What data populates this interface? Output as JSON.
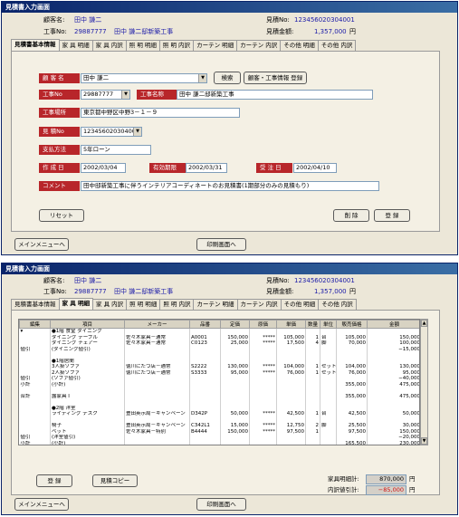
{
  "window1": {
    "title": "見積書入力画面",
    "header": {
      "customer_label": "顧客名:",
      "customer_value": "田中 謙二",
      "job_no_label": "工事No:",
      "job_no_value": "29887777",
      "job_name_value": "田中 謙二邸新築工事",
      "estimate_no_label": "見積No:",
      "estimate_no_value": "123456020304001",
      "total_label": "見積金額:",
      "total_value": "1,357,000",
      "yen": "円"
    },
    "tabs": [
      "見積書基本情報",
      "家 具 明細",
      "家 具 内訳",
      "照 明 明細",
      "照 明 内訳",
      "カーテン 明細",
      "カーテン 内訳",
      "その他 明細",
      "その他 内訳"
    ],
    "form": {
      "customer_label": "顧 客 名",
      "customer_value": "田中 謙二",
      "search_button": "検索",
      "register_button": "顧客・工事情報 登録",
      "job_no_label": "工事No",
      "job_no_value": "29887777",
      "job_name_label": "工事名称",
      "job_name_value": "田中 謙二邸新築工事",
      "location_label": "工事場所",
      "location_value": "東京都中野区中野3－１－９",
      "estimate_no_label": "見 積No",
      "estimate_no_value": "123456020304001",
      "payment_label": "支払方法",
      "payment_value": "5年ローン",
      "created_label": "作 成 日",
      "created_value": "2002/03/04",
      "valid_label": "有効期限",
      "valid_value": "2002/03/31",
      "order_label": "受 注 日",
      "order_value": "2002/04/10",
      "comment_label": "コメント",
      "comment_value": "田中邸新築工事に伴うインテリアコーディネートのお見積書(1期部分のみの見積もり)",
      "reset_button": "リセット",
      "delete_button": "削 除",
      "save_button": "登 録"
    },
    "footer": {
      "menu_button": "メインメニューへ",
      "print_button": "印刷画面へ"
    }
  },
  "window2": {
    "title": "見積書入力画面",
    "header": {
      "customer_label": "顧客名:",
      "customer_value": "田中 謙二",
      "job_no_label": "工事No:",
      "job_no_value": "29887777",
      "job_name_value": "田中 謙二邸新築工事",
      "estimate_no_label": "見積No:",
      "estimate_no_value": "123456020304001",
      "total_label": "見積金額:",
      "total_value": "1,357,000",
      "yen": "円"
    },
    "tabs": [
      "見積書基本情報",
      "家 具 明細",
      "家 具 内訳",
      "照 明 明細",
      "照 明 内訳",
      "カーテン 明細",
      "カーテン 内訳",
      "その他 明細",
      "その他 内訳"
    ],
    "grid": {
      "columns": [
        "編集",
        "項目",
        "メーカー",
        "品番",
        "定価",
        "原価",
        "単価",
        "数量",
        "単位",
        "販売価格",
        "金額"
      ],
      "rows": [
        [
          "▾",
          "●1階 食堂 ダイニング",
          "",
          "",
          "",
          "",
          "",
          "",
          "",
          "",
          ""
        ],
        [
          "",
          "ダイニング テーブル",
          "佐々木家具－通常",
          "A0001",
          "150,000",
          "*****",
          "105,000",
          "1",
          "台",
          "105,000",
          "150,000"
        ],
        [
          "",
          "ダイニング チェアー",
          "佐々木家具－通常",
          "C0123",
          "25,000",
          "*****",
          "17,500",
          "4",
          "脚",
          "70,000",
          "100,000"
        ],
        [
          "値引",
          "(ダイニング値引)",
          "",
          "",
          "",
          "",
          "",
          "",
          "",
          "",
          "−15,000"
        ],
        [
          "",
          "",
          "",
          "",
          "",
          "",
          "",
          "",
          "",
          "",
          ""
        ],
        [
          "",
          "●1階居間",
          "",
          "",
          "",
          "",
          "",
          "",
          "",
          "",
          ""
        ],
        [
          "",
          "3人掛ソファ",
          "徳川にたつ店－通常",
          "S2222",
          "130,000",
          "*****",
          "104,000",
          "1",
          "セット",
          "104,000",
          "130,000"
        ],
        [
          "",
          "2人掛ソファ",
          "徳川にたつ店－通常",
          "S3333",
          "95,000",
          "*****",
          "76,000",
          "1",
          "セット",
          "76,000",
          "95,000"
        ],
        [
          "値引",
          "(ソファ値引)",
          "",
          "",
          "",
          "",
          "",
          "",
          "",
          "",
          "−40,000"
        ],
        [
          "小計",
          "(小計)",
          "",
          "",
          "",
          "",
          "",
          "",
          "",
          "355,000",
          "475,000"
        ],
        [
          "",
          "",
          "",
          "",
          "",
          "",
          "",
          "",
          "",
          "",
          ""
        ],
        [
          "合計",
          "露家具 I",
          "",
          "",
          "",
          "",
          "",
          "",
          "",
          "355,000",
          "475,000"
        ],
        [
          "",
          "",
          "",
          "",
          "",
          "",
          "",
          "",
          "",
          "",
          ""
        ],
        [
          "",
          "●2階 洋室",
          "",
          "",
          "",
          "",
          "",
          "",
          "",
          "",
          ""
        ],
        [
          "",
          "ライティング デスク",
          "豊田英示局－キャンペーン",
          "D342P",
          "50,000",
          "*****",
          "42,500",
          "1",
          "台",
          "42,500",
          "50,000"
        ],
        [
          "",
          "",
          "",
          "",
          "",
          "",
          "",
          "",
          "",
          "",
          ""
        ],
        [
          "",
          "椅子",
          "豊田英示局－キャンペーン",
          "C342L1",
          "15,000",
          "*****",
          "12,750",
          "2",
          "脚",
          "25,500",
          "30,000"
        ],
        [
          "",
          "ベット",
          "佐々木家具－特別",
          "B4444",
          "150,000",
          "*****",
          "97,500",
          "1",
          "",
          "97,500",
          "150,000"
        ],
        [
          "値引",
          "(洋室値引)",
          "",
          "",
          "",
          "",
          "",
          "",
          "",
          "",
          "−20,000"
        ],
        [
          "小計",
          "(小計)",
          "",
          "",
          "",
          "",
          "",
          "",
          "",
          "165,500",
          "230,000"
        ]
      ]
    },
    "totals": {
      "furniture_total_label": "家具明細計:",
      "furniture_total_value": "870,000",
      "discount_label": "内訳値引計:",
      "discount_value": "−85,000",
      "yen": "円"
    },
    "buttons": {
      "save_button": "登 録",
      "copy_button": "見積コピー"
    },
    "footer": {
      "menu_button": "メインメニューへ",
      "print_button": "印刷画面へ"
    }
  }
}
